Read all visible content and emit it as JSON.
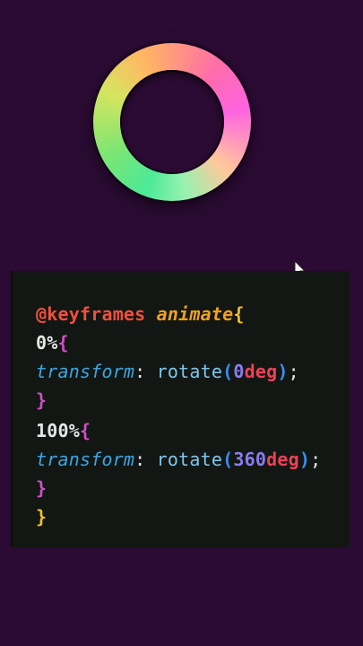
{
  "colors": {
    "background": "#2b0b33",
    "code_background": "#121713",
    "keyword": "#f0503c",
    "animation_name": "#f0a11f",
    "property": "#3aa6e6",
    "number": "#8b7cf0",
    "unit": "#ee4058"
  },
  "icons": {
    "cursor": "mouse-pointer-icon",
    "ring": "gradient-ring"
  },
  "code": {
    "line1": {
      "at": "@",
      "keyword": "keyframes",
      "name": "animate",
      "brace": "{"
    },
    "line2": {
      "selector": "0%",
      "brace": "{"
    },
    "line3": {
      "property": "transform",
      "colon": ":",
      "fn": "rotate",
      "open": "(",
      "num": "0",
      "unit": "deg",
      "close": ")",
      "semi": ";"
    },
    "line4": {
      "brace": "}"
    },
    "line5": {
      "selector": "100%",
      "brace": "{"
    },
    "line6": {
      "property": "transform",
      "colon": ":",
      "fn": "rotate",
      "open": "(",
      "num": "360",
      "unit": "deg",
      "close": ")",
      "semi": ";"
    },
    "line7": {
      "brace": "}"
    },
    "line8": {
      "brace": "}"
    }
  }
}
